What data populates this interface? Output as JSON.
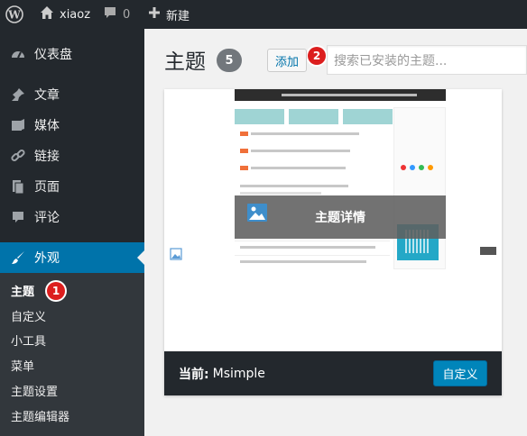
{
  "adminbar": {
    "site_name": "xiaoz",
    "comment_count": "0",
    "new_label": "新建"
  },
  "sidebar": {
    "items": [
      {
        "label": "仪表盘",
        "icon": "dashboard-icon"
      },
      {
        "label": "文章",
        "icon": "pushpin-icon"
      },
      {
        "label": "媒体",
        "icon": "media-icon"
      },
      {
        "label": "链接",
        "icon": "link-icon"
      },
      {
        "label": "页面",
        "icon": "page-icon"
      },
      {
        "label": "评论",
        "icon": "comment-icon"
      },
      {
        "label": "外观",
        "icon": "brush-icon",
        "active": true
      }
    ],
    "submenu": [
      {
        "label": "主题",
        "current": true
      },
      {
        "label": "自定义"
      },
      {
        "label": "小工具"
      },
      {
        "label": "菜单"
      },
      {
        "label": "主题设置"
      },
      {
        "label": "主题编辑器"
      }
    ]
  },
  "markers": {
    "first": "1",
    "second": "2"
  },
  "main": {
    "title": "主题",
    "count": "5",
    "add_label": "添加",
    "search_placeholder": "搜索已安装的主题..."
  },
  "theme_card": {
    "overlay_label": "主题详情",
    "current_prefix": "当前:",
    "theme_name": "Msimple",
    "customize_label": "自定义"
  },
  "colors": {
    "admin_dark": "#23282d",
    "submenu_bg": "#32373c",
    "accent": "#0073aa",
    "button_blue": "#0085ba",
    "marker_red": "#dc1e1e"
  }
}
